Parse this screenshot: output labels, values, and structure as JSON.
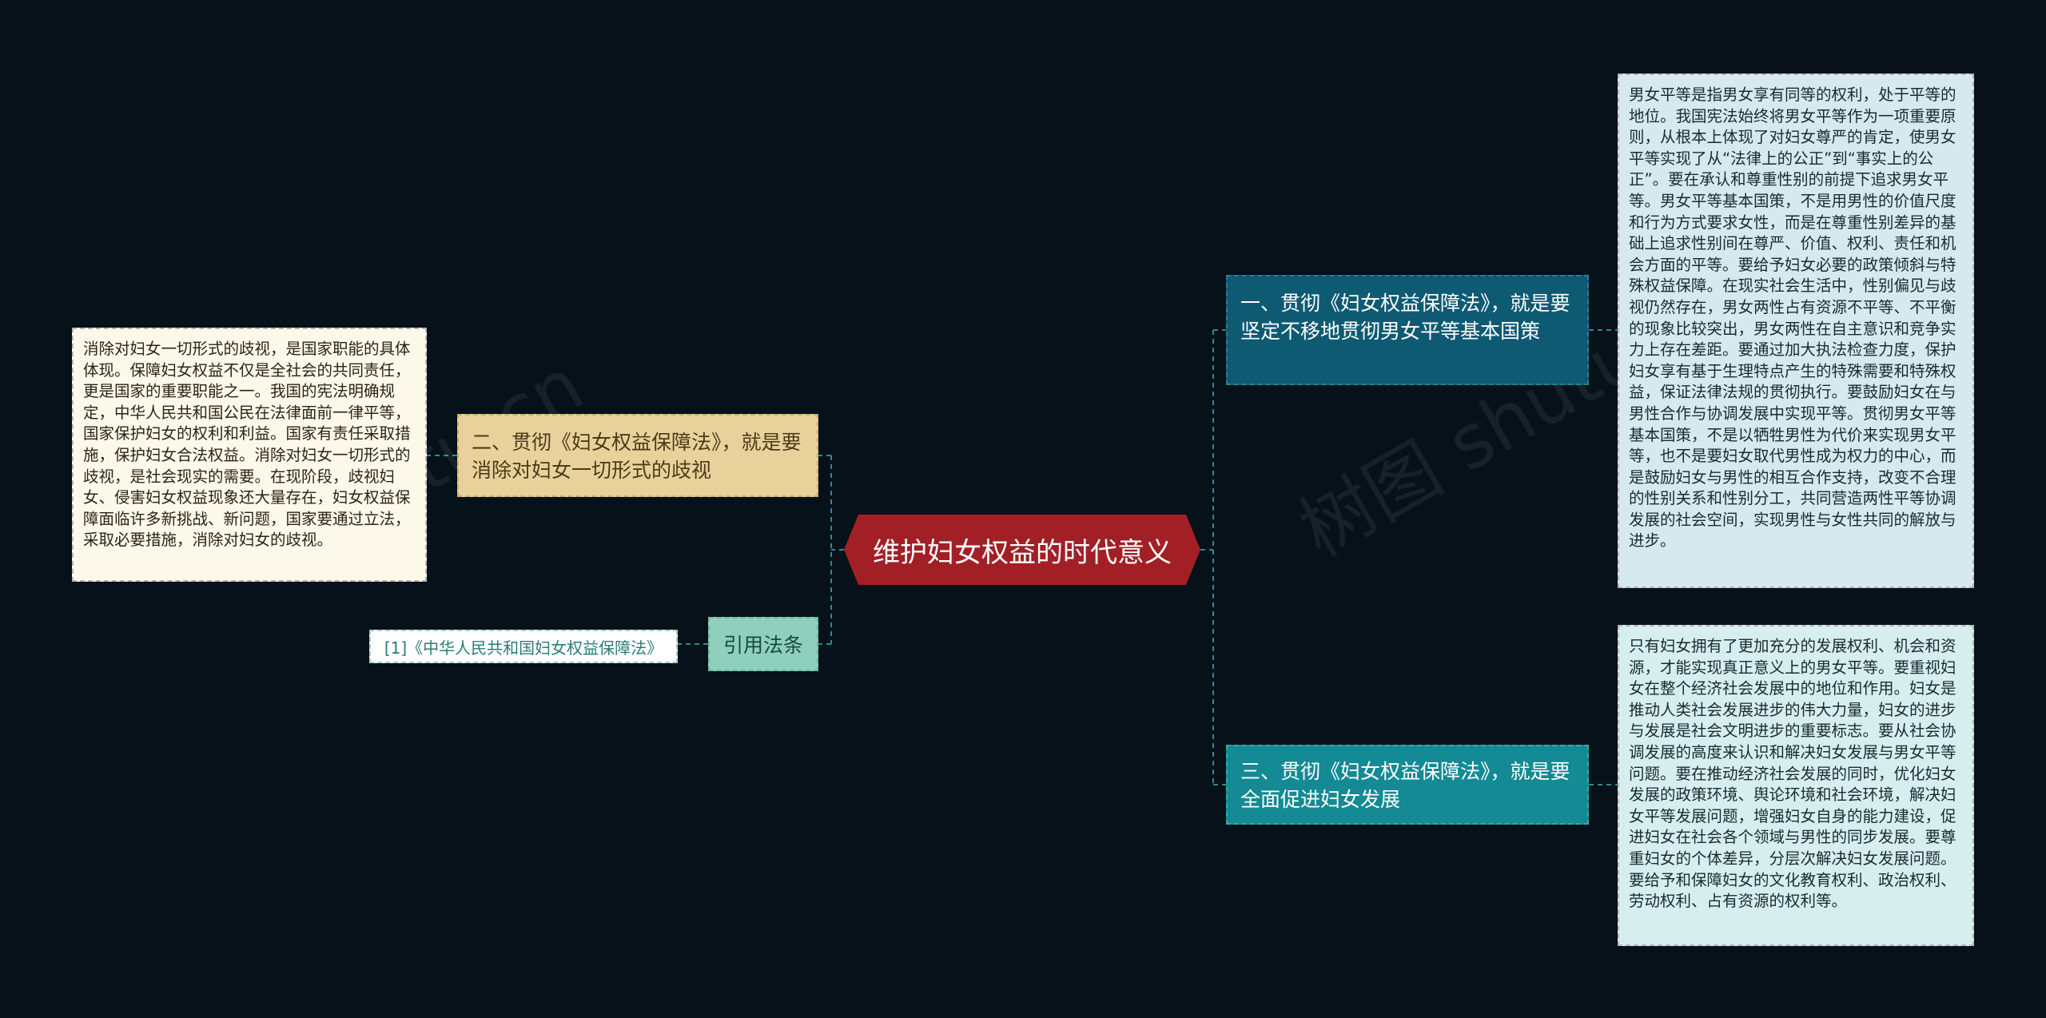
{
  "root": {
    "label": "维护妇女权益的时代意义"
  },
  "branches": {
    "b1": {
      "label": "一、贯彻《妇女权益保障法》，就是要坚定不移地贯彻男女平等基本国策",
      "detail": "男女平等是指男女享有同等的权利，处于平等的地位。我国宪法始终将男女平等作为一项重要原则，从根本上体现了对妇女尊严的肯定，使男女平等实现了从“法律上的公正”到“事实上的公正”。要在承认和尊重性别的前提下追求男女平等。男女平等基本国策，不是用男性的价值尺度和行为方式要求女性，而是在尊重性别差异的基础上追求性别间在尊严、价值、权利、责任和机会方面的平等。要给予妇女必要的政策倾斜与特殊权益保障。在现实社会生活中，性别偏见与歧视仍然存在，男女两性占有资源不平等、不平衡的现象比较突出，男女两性在自主意识和竞争实力上存在差距。要通过加大执法检查力度，保护妇女享有基于生理特点产生的特殊需要和特殊权益，保证法律法规的贯彻执行。要鼓励妇女在与男性合作与协调发展中实现平等。贯彻男女平等基本国策，不是以牺牲男性为代价来实现男女平等，也不是要妇女取代男性成为权力的中心，而是鼓励妇女与男性的相互合作支持，改变不合理的性别关系和性别分工，共同营造两性平等协调发展的社会空间，实现男性与女性共同的解放与进步。"
    },
    "b2": {
      "label": "二、贯彻《妇女权益保障法》，就是要消除对妇女一切形式的歧视",
      "detail": "消除对妇女一切形式的歧视，是国家职能的具体体现。保障妇女权益不仅是全社会的共同责任，更是国家的重要职能之一。我国的宪法明确规定，中华人民共和国公民在法律面前一律平等，国家保护妇女的权利和利益。国家有责任采取措施，保护妇女合法权益。消除对妇女一切形式的歧视，是社会现实的需要。在现阶段，歧视妇女、侵害妇女权益现象还大量存在，妇女权益保障面临许多新挑战、新问题，国家要通过立法，采取必要措施，消除对妇女的歧视。"
    },
    "b3": {
      "label": "三、贯彻《妇女权益保障法》，就是要全面促进妇女发展",
      "detail": "只有妇女拥有了更加充分的发展权利、机会和资源，才能实现真正意义上的男女平等。要重视妇女在整个经济社会发展中的地位和作用。妇女是推动人类社会发展进步的伟大力量，妇女的进步与发展是社会文明进步的重要标志。要从社会协调发展的高度来认识和解决妇女发展与男女平等问题。要在推动经济社会发展的同时，优化妇女发展的政策环境、舆论环境和社会环境，解决妇女平等发展问题，增强妇女自身的能力建设，促进妇女在社会各个领域与男性的同步发展。要尊重妇女的个体差异，分层次解决妇女发展问题。要给予和保障妇女的文化教育权利、政治权利、劳动权利、占有资源的权利等。"
    },
    "cite": {
      "label": "引用法条",
      "detail": "[1]《中华人民共和国妇女权益保障法》"
    }
  },
  "watermarks": [
    "shutu.cn",
    "树图 shutu"
  ],
  "colors": {
    "background": "#06111a",
    "root": "#a31f26",
    "b1": "#0f5a73",
    "b2": "#e8d19a",
    "b3": "#138a94",
    "cite": "#8ed0bb",
    "connector": "#2f8a93"
  }
}
